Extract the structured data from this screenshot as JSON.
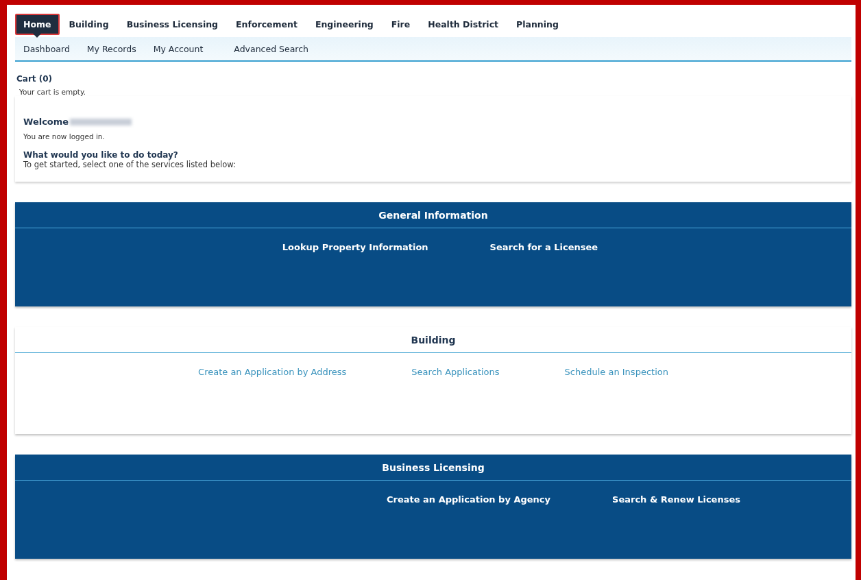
{
  "main_nav": [
    {
      "label": "Home",
      "selected": true
    },
    {
      "label": "Building",
      "selected": false
    },
    {
      "label": "Business Licensing",
      "selected": false
    },
    {
      "label": "Enforcement",
      "selected": false
    },
    {
      "label": "Engineering",
      "selected": false
    },
    {
      "label": "Fire",
      "selected": false
    },
    {
      "label": "Health District",
      "selected": false
    },
    {
      "label": "Planning",
      "selected": false
    }
  ],
  "sub_nav": [
    "Dashboard",
    "My Records",
    "My Account",
    "Advanced Search"
  ],
  "cart": {
    "title": "Cart (0)",
    "message": "Your cart is empty."
  },
  "welcome": {
    "greeting": "Welcome",
    "status": "You are now logged in.",
    "question": "What would you like to do today?",
    "instruction": "To get started, select one of the services listed below:"
  },
  "sections": [
    {
      "title": "General Information",
      "kind": "dark",
      "links": [
        "Lookup Property Information",
        "Search for a Licensee"
      ]
    },
    {
      "title": "Building",
      "kind": "light",
      "links": [
        "Create an Application by Address",
        "Search Applications",
        "Schedule an Inspection"
      ]
    },
    {
      "title": "Business Licensing",
      "kind": "dark",
      "links": [
        "Create an Application by Agency",
        "Search & Renew Licenses"
      ]
    }
  ]
}
